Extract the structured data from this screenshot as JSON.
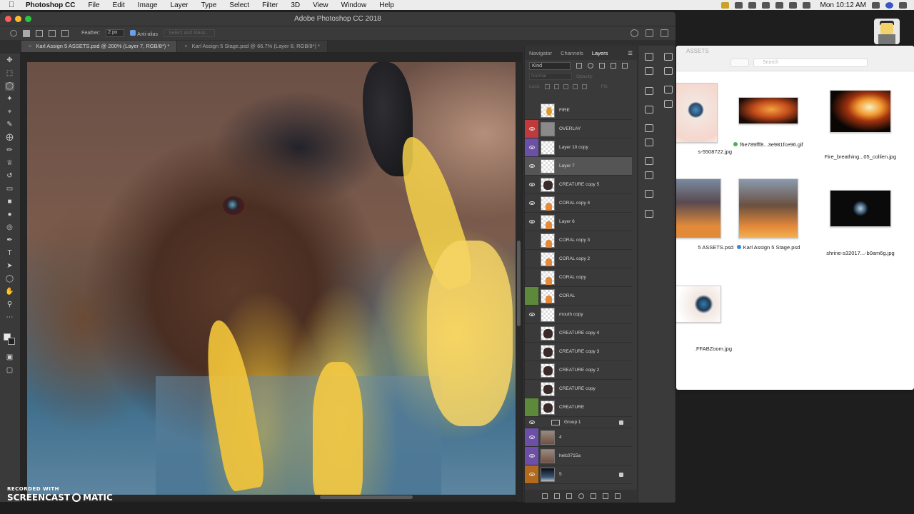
{
  "menubar": {
    "app_name": "Photoshop CC",
    "items": [
      "File",
      "Edit",
      "Image",
      "Layer",
      "Type",
      "Select",
      "Filter",
      "3D",
      "View",
      "Window",
      "Help"
    ],
    "clock": "Mon 10:12 AM"
  },
  "window": {
    "title": "Adobe Photoshop CC 2018"
  },
  "options": {
    "feather_label": "Feather:",
    "feather_value": "2 px",
    "antialias_label": "Anti-alias",
    "select_mask_label": "Select and Mask..."
  },
  "tabs": [
    {
      "label": "Karl Assign 5 ASSETS.psd @ 200% (Layer 7, RGB/8*) *",
      "active": true
    },
    {
      "label": "Karl Assign 5 Stage.psd @ 66.7% (Layer 8, RGB/8*) *",
      "active": false
    }
  ],
  "layers_panel": {
    "tabs": [
      "Navigator",
      "Channels",
      "Layers"
    ],
    "filter_kind": "Kind",
    "blend_mode": "Normal",
    "opacity_label": "Opacity:",
    "lock_label": "Lock:",
    "fill_label": "Fill:",
    "layers": [
      {
        "name": "FIRE",
        "color": "",
        "visible": false,
        "thumb": "fire"
      },
      {
        "name": "OVERLAY",
        "color": "red",
        "visible": true,
        "thumb": "overlay"
      },
      {
        "name": "Layer 10 copy",
        "color": "purple",
        "visible": true,
        "thumb": "blank"
      },
      {
        "name": "Layer 7",
        "color": "",
        "visible": true,
        "thumb": "blank",
        "selected": true
      },
      {
        "name": "CREATURE copy 5",
        "color": "",
        "visible": true,
        "thumb": "creature"
      },
      {
        "name": "CORAL copy 4",
        "color": "",
        "visible": true,
        "thumb": "coral"
      },
      {
        "name": "Layer 6",
        "color": "",
        "visible": true,
        "thumb": "coral"
      },
      {
        "name": "CORAL copy 3",
        "color": "",
        "visible": false,
        "thumb": "coral"
      },
      {
        "name": "CORAL copy 2",
        "color": "",
        "visible": false,
        "thumb": "coral"
      },
      {
        "name": "CORAL copy",
        "color": "",
        "visible": false,
        "thumb": "coral"
      },
      {
        "name": "CORAL",
        "color": "green",
        "visible": false,
        "thumb": "coral"
      },
      {
        "name": "mouth copy",
        "color": "",
        "visible": true,
        "thumb": "blank"
      },
      {
        "name": "CREATURE copy 4",
        "color": "",
        "visible": false,
        "thumb": "creature"
      },
      {
        "name": "CREATURE copy 3",
        "color": "",
        "visible": false,
        "thumb": "creature"
      },
      {
        "name": "CREATURE copy 2",
        "color": "",
        "visible": false,
        "thumb": "creature"
      },
      {
        "name": "CREATURE copy",
        "color": "",
        "visible": false,
        "thumb": "creature"
      },
      {
        "name": "CREATURE",
        "color": "green",
        "visible": false,
        "thumb": "creature"
      },
      {
        "name": "Group 1",
        "color": "",
        "visible": true,
        "group": true,
        "locked": true
      },
      {
        "name": "4",
        "color": "purple",
        "visible": true,
        "thumb": "photo"
      },
      {
        "name": "helc0715a",
        "color": "purple",
        "visible": true,
        "thumb": "photo"
      },
      {
        "name": "5",
        "color": "orange",
        "visible": true,
        "thumb": "bg",
        "locked": true
      }
    ]
  },
  "finder": {
    "title": "ASSETS",
    "search_placeholder": "Search",
    "files": [
      {
        "name": "s-5508722.jpg",
        "tag": ""
      },
      {
        "name": "f6e789fff8...3e981fce96.gif",
        "tag": "#4caf50"
      },
      {
        "name": "Fire_breathing...05_collien.jpg",
        "tag": ""
      },
      {
        "name": "5 ASSETS.psd",
        "tag": ""
      },
      {
        "name": "Karl Assign 5 Stage.psd",
        "tag": "#3a86d6"
      },
      {
        "name": "shrine-s32017...-b0am6g.jpg",
        "tag": ""
      },
      {
        "name": ".FFABZoom.jpg",
        "tag": ""
      }
    ]
  },
  "watermark": {
    "line1": "RECORDED WITH",
    "line2_left": "SCREENCAST",
    "line2_right": "MATIC"
  }
}
